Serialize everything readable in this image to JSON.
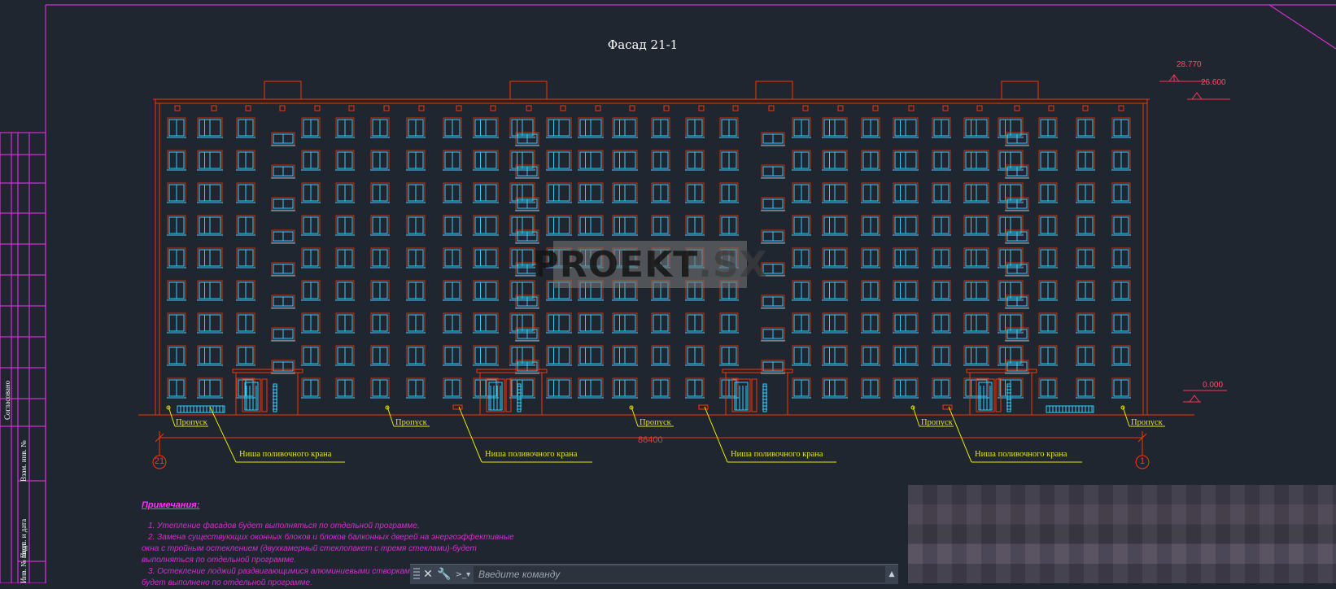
{
  "drawing": {
    "title": "Фасад 21-1",
    "watermark_left": "PROEKT",
    "watermark_right": ".SX",
    "elevations": [
      "28.770",
      "26.600",
      "0.000"
    ],
    "dimension": "86400",
    "axes": [
      "21",
      "1"
    ],
    "callouts_propusk": [
      "Пропуск",
      "Пропуск",
      "Пропуск",
      "Пропуск",
      "Пропуск"
    ],
    "callouts_nisha": [
      "Ниша поливочного крана",
      "Ниша поливочного крана",
      "Ниша поливочного крана",
      "Ниша поливочного крана"
    ]
  },
  "notes": {
    "title": "Примечания:",
    "lines": [
      "1. Утепление фасадов будет выполняться по отдельной программе.",
      "2. Замена существующих оконных блоков и блоков балконных дверей на энергоэффективные",
      "окна с тройным остеклением (двухкамерный стеклопакет с тремя стеклами)-будет",
      "выполняться по отдельной программе.",
      "3. Остекление лоджий раздвигающимися алюминиевыми створками",
      "будет выполнено по отдельной программе."
    ]
  },
  "stamp": {
    "labels": [
      "Согласовано",
      "Взам. инв. №",
      "Подп. и дата",
      "Инв. № подл."
    ]
  },
  "command_bar": {
    "placeholder": "Введите команду",
    "close_icon": "close-icon",
    "settings_icon": "wrench-icon",
    "prompt_icon": "command-prompt-icon"
  },
  "colors": {
    "background": "#1f2630",
    "building_lines": "#ff3300",
    "windows": "#33ccff",
    "callouts": "#e6e600",
    "frame": "#cc33cc"
  }
}
